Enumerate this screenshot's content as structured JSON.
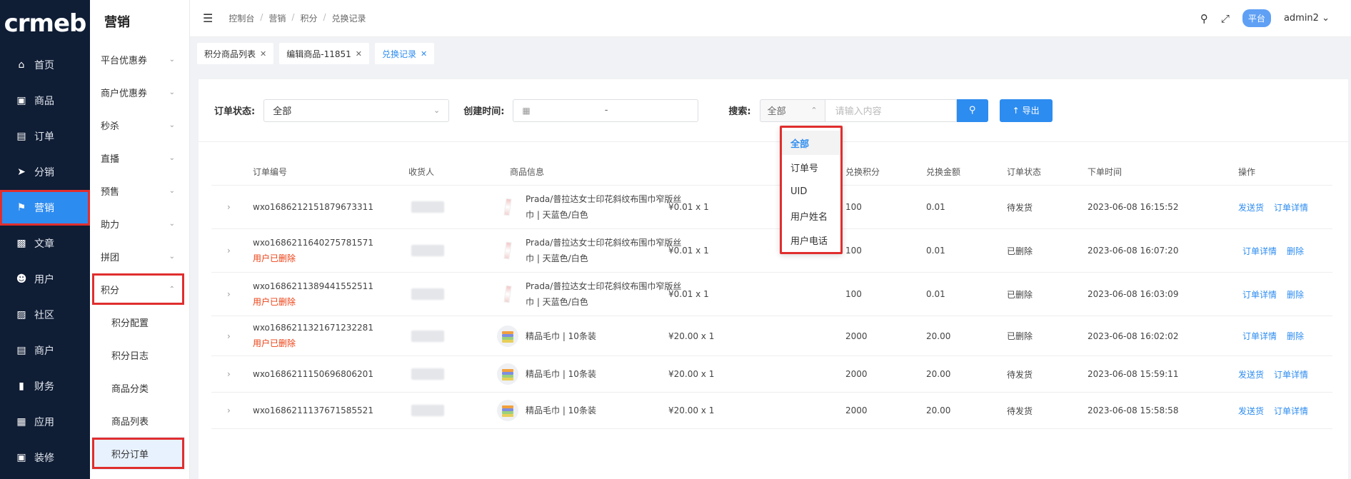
{
  "logo": {
    "text": "crmeb"
  },
  "nav": {
    "items": [
      {
        "label": "首页",
        "icon": "home-icon"
      },
      {
        "label": "商品",
        "icon": "bag-icon"
      },
      {
        "label": "订单",
        "icon": "order-icon"
      },
      {
        "label": "分销",
        "icon": "send-icon"
      },
      {
        "label": "营销",
        "icon": "flag-icon"
      },
      {
        "label": "文章",
        "icon": "article-icon"
      },
      {
        "label": "用户",
        "icon": "user-icon"
      },
      {
        "label": "社区",
        "icon": "community-icon"
      },
      {
        "label": "商户",
        "icon": "merchant-icon"
      },
      {
        "label": "财务",
        "icon": "finance-icon"
      },
      {
        "label": "应用",
        "icon": "grid-icon"
      },
      {
        "label": "装修",
        "icon": "decorate-icon"
      }
    ],
    "active": "营销"
  },
  "submenu": {
    "title": "营销",
    "items": [
      {
        "label": "平台优惠券"
      },
      {
        "label": "商户优惠券"
      },
      {
        "label": "秒杀"
      },
      {
        "label": "直播"
      },
      {
        "label": "预售"
      },
      {
        "label": "助力"
      },
      {
        "label": "拼团"
      },
      {
        "label": "积分"
      }
    ],
    "children": [
      {
        "label": "积分配置"
      },
      {
        "label": "积分日志"
      },
      {
        "label": "商品分类"
      },
      {
        "label": "商品列表"
      },
      {
        "label": "积分订单"
      }
    ]
  },
  "header": {
    "breadcrumb": [
      "控制台",
      "营销",
      "积分",
      "兑换记录"
    ],
    "platform_badge": "平台",
    "user": "admin2"
  },
  "tabs": [
    {
      "label": "积分商品列表"
    },
    {
      "label": "编辑商品-11851"
    },
    {
      "label": "兑换记录"
    }
  ],
  "filter": {
    "status_label": "订单状态:",
    "status_value": "全部",
    "time_label": "创建时间:",
    "time_sep": "-",
    "search_label": "搜索:",
    "search_type": "全部",
    "search_placeholder": "请输入内容",
    "export_label": "导出"
  },
  "dropdown": {
    "options": [
      "全部",
      "订单号",
      "UID",
      "用户姓名",
      "用户电话"
    ],
    "selected": "全部"
  },
  "table": {
    "columns": [
      "订单编号",
      "收货人",
      "商品信息",
      "兑换积分",
      "兑换金额",
      "订单状态",
      "下单时间",
      "操作"
    ],
    "rows": [
      {
        "order_no": "wxo1686212151879673311",
        "deleted": "",
        "product": "Prada/普拉达女士印花斜纹布围巾窄版丝巾 | 天蓝色/白色",
        "price": "¥0.01 x 1",
        "points": "100",
        "amount": "0.01",
        "status": "待发货",
        "time": "2023-06-08 16:15:52",
        "actions": [
          "发送货",
          "订单详情"
        ],
        "img": "scarf"
      },
      {
        "order_no": "wxo1686211640275781571",
        "deleted": "用户已删除",
        "product": "Prada/普拉达女士印花斜纹布围巾窄版丝巾 | 天蓝色/白色",
        "price": "¥0.01 x 1",
        "points": "100",
        "amount": "0.01",
        "status": "已删除",
        "time": "2023-06-08 16:07:20",
        "actions": [
          "订单详情",
          "删除"
        ],
        "img": "scarf"
      },
      {
        "order_no": "wxo1686211389441552511",
        "deleted": "用户已删除",
        "product": "Prada/普拉达女士印花斜纹布围巾窄版丝巾 | 天蓝色/白色",
        "price": "¥0.01 x 1",
        "points": "100",
        "amount": "0.01",
        "status": "已删除",
        "time": "2023-06-08 16:03:09",
        "actions": [
          "订单详情",
          "删除"
        ],
        "img": "scarf"
      },
      {
        "order_no": "wxo1686211321671232281",
        "deleted": "用户已删除",
        "product": "精品毛巾 | 10条装",
        "price": "¥20.00 x 1",
        "points": "2000",
        "amount": "20.00",
        "status": "已删除",
        "time": "2023-06-08 16:02:02",
        "actions": [
          "订单详情",
          "删除"
        ],
        "img": "towel"
      },
      {
        "order_no": "wxo1686211150696806201",
        "deleted": "",
        "product": "精品毛巾 | 10条装",
        "price": "¥20.00 x 1",
        "points": "2000",
        "amount": "20.00",
        "status": "待发货",
        "time": "2023-06-08 15:59:11",
        "actions": [
          "发送货",
          "订单详情"
        ],
        "img": "towel"
      },
      {
        "order_no": "wxo1686211137671585521",
        "deleted": "",
        "product": "精品毛巾 | 10条装",
        "price": "¥20.00 x 1",
        "points": "2000",
        "amount": "20.00",
        "status": "待发货",
        "time": "2023-06-08 15:58:58",
        "actions": [
          "发送货",
          "订单详情"
        ],
        "img": "towel"
      }
    ]
  },
  "colors": {
    "primary": "#2d8cf0",
    "nav_bg": "#0f1d35",
    "highlight": "#e02e2e",
    "danger": "#ed4014"
  }
}
